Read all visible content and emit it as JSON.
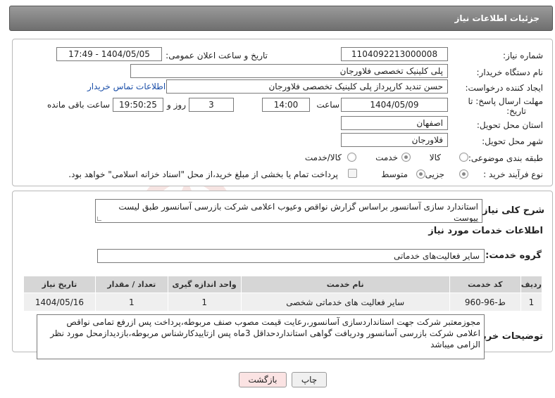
{
  "header": {
    "title": "جزئیات اطلاعات نیاز"
  },
  "need_number": {
    "label": "شماره نیاز:",
    "value": "1104092213000008"
  },
  "announce_datetime": {
    "label": "تاریخ و ساعت اعلان عمومی:",
    "value": "1404/05/05 - 17:49"
  },
  "buyer_org": {
    "label": "نام دستگاه خریدار:",
    "value": "پلی کلینیک تخصصی فلاورجان"
  },
  "requester": {
    "label": "ایجاد کننده درخواست:",
    "value": "حسن تندید کارپرداز پلی کلینیک تخصصی فلاورجان",
    "contact_link": "اطلاعات تماس خریدار"
  },
  "deadline": {
    "label_line1": "مهلت ارسال پاسخ: تا",
    "label_line2": "تاریخ:",
    "date": "1404/05/09",
    "time_label": "ساعت",
    "time": "14:00",
    "days_label": "روز و",
    "days": "3",
    "remaining_time": "19:50:25",
    "remaining_label": "ساعت باقی مانده"
  },
  "province": {
    "label": "استان محل تحویل:",
    "value": "اصفهان"
  },
  "city": {
    "label": "شهر محل تحویل:",
    "value": "فلاورجان"
  },
  "category": {
    "label": "طبقه بندی موضوعی:",
    "options": [
      "کالا",
      "خدمت",
      "کالا/خدمت"
    ],
    "selected": "خدمت"
  },
  "purchase_type": {
    "label": "نوع فرآیند خرید :",
    "options": [
      "جزیی",
      "متوسط"
    ],
    "selected": "جزیی",
    "payment_note": "پرداخت تمام یا بخشی از مبلغ خرید،از محل \"اسناد خزانه اسلامی\" خواهد بود."
  },
  "general_description": {
    "label": "شرح کلی نیاز:",
    "value": "استاندارد سازی آسانسور براساس گزارش نواقص وعیوب اعلامی شرکت بازرسی آسانسور طبق لیست پیوست"
  },
  "services_info": {
    "title": "اطلاعات خدمات مورد نیاز"
  },
  "service_group": {
    "label": "گروه خدمت:",
    "value": "سایر فعالیت‌های خدماتی"
  },
  "table": {
    "headers": [
      "ردیف",
      "کد خدمت",
      "نام خدمت",
      "واحد اندازه گیری",
      "تعداد / مقدار",
      "تاریخ نیاز"
    ],
    "rows": [
      [
        "1",
        "ط-96-960",
        "سایر فعالیت های خدماتی شخصی",
        "1",
        "1",
        "1404/05/16"
      ]
    ]
  },
  "buyer_notes": {
    "label": "توضیحات خریدار:",
    "value": "مجوزمعتبر شرکت جهت استانداردسازی آسانسور،رعایت قیمت مصوب صنف مربوطه،پرداخت پس ازرفع تمامی نواقص اعلامی شرکت بازرسی آسانسور ودریافت گواهی استانداردحداقل 3ماه پس ازتاییدکارشناس مربوطه،بازدیدازمحل مورد نظر الزامی میباشد"
  },
  "buttons": {
    "print": "چاپ",
    "back": "بازگشت"
  },
  "watermark_text": "AriaTender.neT"
}
